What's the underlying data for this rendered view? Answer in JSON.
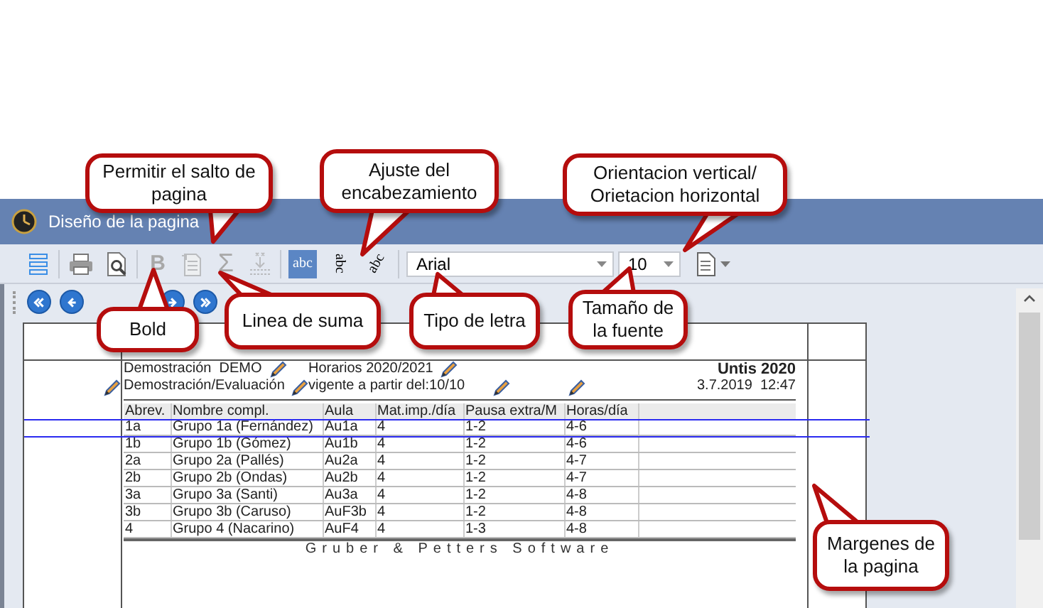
{
  "window": {
    "title": "Diseño de la pagina"
  },
  "toolbar": [
    [
      {
        "kind": "list",
        "disabled": false
      }
    ],
    [
      {
        "kind": "print",
        "disabled": false
      },
      {
        "kind": "preview",
        "disabled": false
      }
    ],
    [
      {
        "kind": "bold",
        "label": "B",
        "disabled": true
      },
      {
        "kind": "page-break",
        "disabled": true
      },
      {
        "kind": "sum",
        "label": "Σ",
        "disabled": true
      },
      {
        "kind": "sum-line",
        "disabled": true
      }
    ],
    [
      {
        "kind": "align-h",
        "label": "abc",
        "selected": true,
        "disabled": false
      },
      {
        "kind": "align-v",
        "label": "abc",
        "selected": false,
        "disabled": false
      },
      {
        "kind": "align-diag",
        "label": "abc",
        "selected": false,
        "disabled": false
      }
    ],
    [
      {
        "kind": "font",
        "value": "Arial",
        "disabled": false
      },
      {
        "kind": "size",
        "value": "10",
        "disabled": false
      },
      {
        "kind": "orientation",
        "disabled": false
      }
    ]
  ],
  "navigation": [
    {
      "kind": "first"
    },
    {
      "kind": "prev"
    },
    {
      "kind": "next"
    },
    {
      "kind": "last"
    }
  ],
  "report": {
    "school": "Demostración  DEMO",
    "subtitle": "Demostración/Evaluación",
    "schedule": "Horarios 2020/2021",
    "valid_from": "vigente a partir del:10/10",
    "product": "Untis 2020",
    "timestamp": "3.7.2019  12:47",
    "columns": [
      "Abrev.",
      "Nombre compl.",
      "Aula",
      "Mat.imp./día",
      "Pausa extra/M",
      "Horas/día"
    ],
    "rows": [
      [
        "1a",
        "Grupo 1a (Fernández)",
        "Au1a",
        "4",
        "1-2",
        "4-6"
      ],
      [
        "1b",
        "Grupo 1b (Gómez)",
        "Au1b",
        "4",
        "1-2",
        "4-6"
      ],
      [
        "2a",
        "Grupo 2a (Pallés)",
        "Au2a",
        "4",
        "1-2",
        "4-7"
      ],
      [
        "2b",
        "Grupo 2b (Ondas)",
        "Au2b",
        "4",
        "1-2",
        "4-7"
      ],
      [
        "3a",
        "Grupo 3a (Santi)",
        "Au3a",
        "4",
        "1-2",
        "4-8"
      ],
      [
        "3b",
        "Grupo 3b (Caruso)",
        "AuF3b",
        "4",
        "1-2",
        "4-8"
      ],
      [
        "4",
        "Grupo 4 (Nacarino)",
        "AuF4",
        "4",
        "1-3",
        "4-8"
      ]
    ],
    "footer": "Gruber & Petters Software"
  },
  "callouts": [
    {
      "text": "Permitir el salto de pagina"
    },
    {
      "text": "Ajuste del encabezamiento"
    },
    {
      "text": "Orientacion vertical/ Orietacion horizontal"
    },
    {
      "text": "Bold"
    },
    {
      "text": "Linea de suma"
    },
    {
      "text": "Tipo de letra"
    },
    {
      "text": "Tamaño de la fuente"
    },
    {
      "text": "Margenes de la pagina"
    }
  ]
}
